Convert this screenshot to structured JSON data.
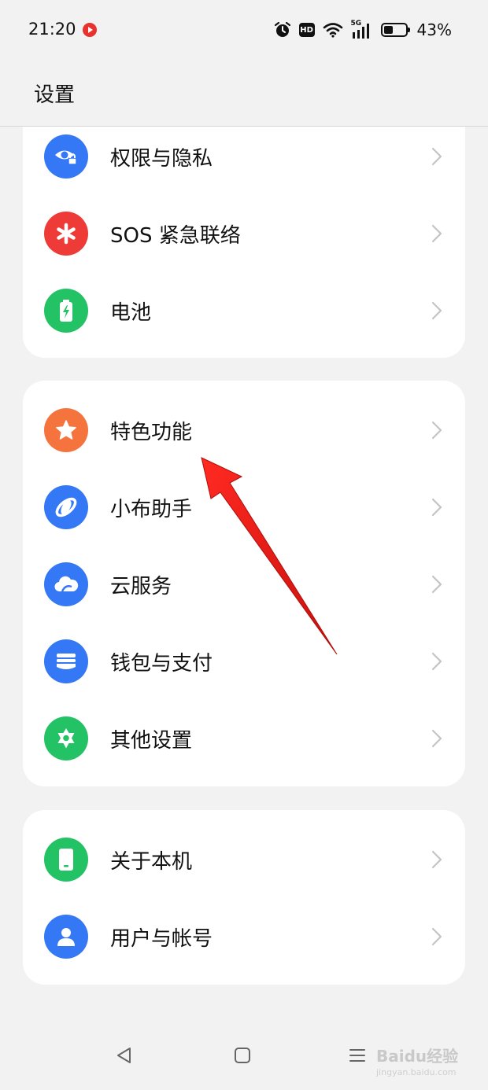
{
  "status_bar": {
    "time": "21:20",
    "battery_percent": "43%",
    "battery_level": 0.43,
    "network": "5G",
    "hd_label": "HD"
  },
  "header": {
    "title": "设置"
  },
  "groups": [
    {
      "items": [
        {
          "label": "权限与隐私",
          "icon": "privacy-eye-lock-icon",
          "color": "#3478f6"
        },
        {
          "label": "SOS 紧急联络",
          "icon": "sos-asterisk-icon",
          "color": "#ee3b38"
        },
        {
          "label": "电池",
          "icon": "battery-icon",
          "color": "#23c265"
        }
      ]
    },
    {
      "items": [
        {
          "label": "特色功能",
          "icon": "star-icon",
          "color": "#f5743e"
        },
        {
          "label": "小布助手",
          "icon": "assistant-orbit-icon",
          "color": "#3478f6"
        },
        {
          "label": "云服务",
          "icon": "cloud-icon",
          "color": "#3478f6"
        },
        {
          "label": "钱包与支付",
          "icon": "wallet-icon",
          "color": "#3478f6"
        },
        {
          "label": "其他设置",
          "icon": "gear-icon",
          "color": "#23c265"
        }
      ]
    },
    {
      "items": [
        {
          "label": "关于本机",
          "icon": "phone-device-icon",
          "color": "#23c265"
        },
        {
          "label": "用户与帐号",
          "icon": "user-icon",
          "color": "#3478f6"
        }
      ]
    }
  ],
  "watermark": {
    "text": "Baidu经验",
    "sub": "jingyan.baidu.com"
  },
  "annotation": {
    "color": "#e8201c",
    "target": "特色功能"
  }
}
